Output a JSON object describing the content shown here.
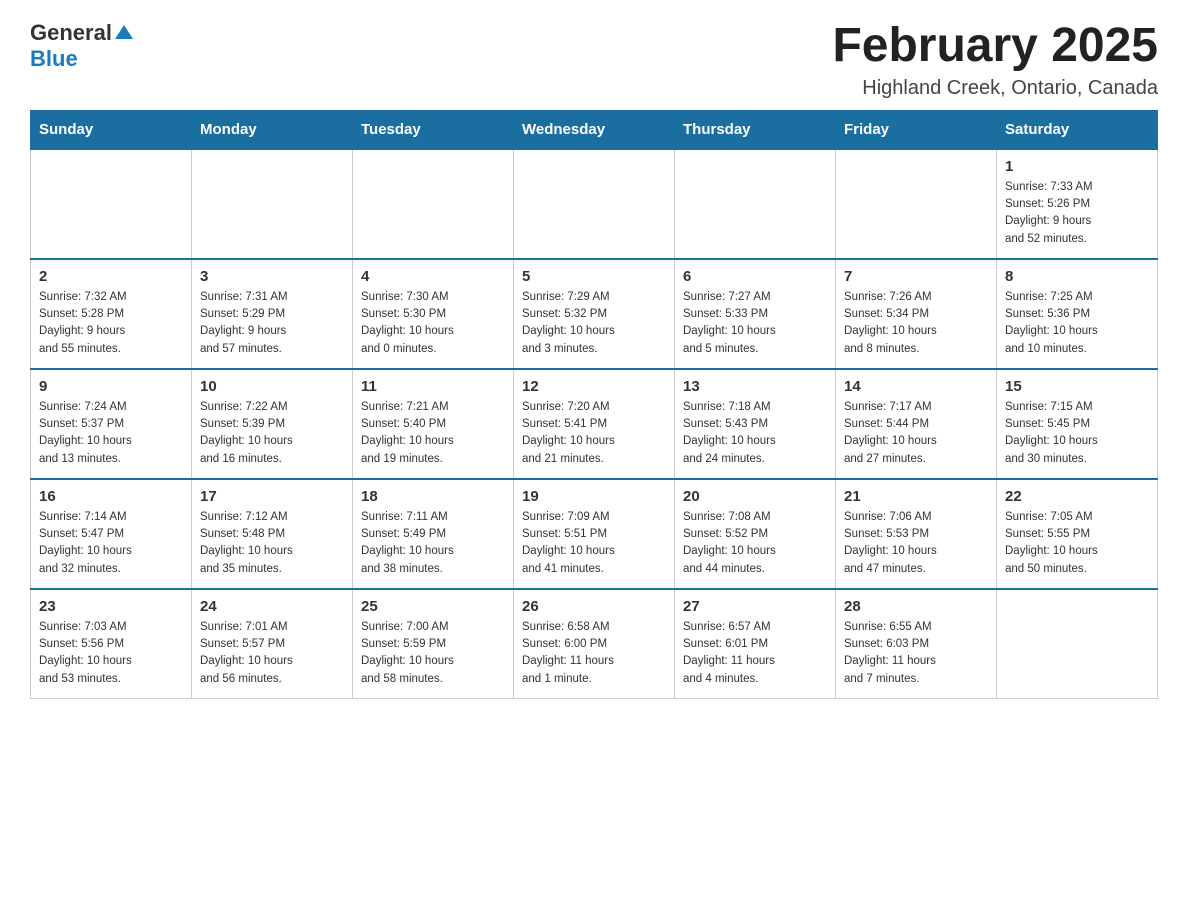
{
  "header": {
    "logo_general": "General",
    "logo_blue": "Blue",
    "month_title": "February 2025",
    "location": "Highland Creek, Ontario, Canada"
  },
  "weekdays": [
    "Sunday",
    "Monday",
    "Tuesday",
    "Wednesday",
    "Thursday",
    "Friday",
    "Saturday"
  ],
  "weeks": [
    [
      {
        "day": "",
        "info": ""
      },
      {
        "day": "",
        "info": ""
      },
      {
        "day": "",
        "info": ""
      },
      {
        "day": "",
        "info": ""
      },
      {
        "day": "",
        "info": ""
      },
      {
        "day": "",
        "info": ""
      },
      {
        "day": "1",
        "info": "Sunrise: 7:33 AM\nSunset: 5:26 PM\nDaylight: 9 hours\nand 52 minutes."
      }
    ],
    [
      {
        "day": "2",
        "info": "Sunrise: 7:32 AM\nSunset: 5:28 PM\nDaylight: 9 hours\nand 55 minutes."
      },
      {
        "day": "3",
        "info": "Sunrise: 7:31 AM\nSunset: 5:29 PM\nDaylight: 9 hours\nand 57 minutes."
      },
      {
        "day": "4",
        "info": "Sunrise: 7:30 AM\nSunset: 5:30 PM\nDaylight: 10 hours\nand 0 minutes."
      },
      {
        "day": "5",
        "info": "Sunrise: 7:29 AM\nSunset: 5:32 PM\nDaylight: 10 hours\nand 3 minutes."
      },
      {
        "day": "6",
        "info": "Sunrise: 7:27 AM\nSunset: 5:33 PM\nDaylight: 10 hours\nand 5 minutes."
      },
      {
        "day": "7",
        "info": "Sunrise: 7:26 AM\nSunset: 5:34 PM\nDaylight: 10 hours\nand 8 minutes."
      },
      {
        "day": "8",
        "info": "Sunrise: 7:25 AM\nSunset: 5:36 PM\nDaylight: 10 hours\nand 10 minutes."
      }
    ],
    [
      {
        "day": "9",
        "info": "Sunrise: 7:24 AM\nSunset: 5:37 PM\nDaylight: 10 hours\nand 13 minutes."
      },
      {
        "day": "10",
        "info": "Sunrise: 7:22 AM\nSunset: 5:39 PM\nDaylight: 10 hours\nand 16 minutes."
      },
      {
        "day": "11",
        "info": "Sunrise: 7:21 AM\nSunset: 5:40 PM\nDaylight: 10 hours\nand 19 minutes."
      },
      {
        "day": "12",
        "info": "Sunrise: 7:20 AM\nSunset: 5:41 PM\nDaylight: 10 hours\nand 21 minutes."
      },
      {
        "day": "13",
        "info": "Sunrise: 7:18 AM\nSunset: 5:43 PM\nDaylight: 10 hours\nand 24 minutes."
      },
      {
        "day": "14",
        "info": "Sunrise: 7:17 AM\nSunset: 5:44 PM\nDaylight: 10 hours\nand 27 minutes."
      },
      {
        "day": "15",
        "info": "Sunrise: 7:15 AM\nSunset: 5:45 PM\nDaylight: 10 hours\nand 30 minutes."
      }
    ],
    [
      {
        "day": "16",
        "info": "Sunrise: 7:14 AM\nSunset: 5:47 PM\nDaylight: 10 hours\nand 32 minutes."
      },
      {
        "day": "17",
        "info": "Sunrise: 7:12 AM\nSunset: 5:48 PM\nDaylight: 10 hours\nand 35 minutes."
      },
      {
        "day": "18",
        "info": "Sunrise: 7:11 AM\nSunset: 5:49 PM\nDaylight: 10 hours\nand 38 minutes."
      },
      {
        "day": "19",
        "info": "Sunrise: 7:09 AM\nSunset: 5:51 PM\nDaylight: 10 hours\nand 41 minutes."
      },
      {
        "day": "20",
        "info": "Sunrise: 7:08 AM\nSunset: 5:52 PM\nDaylight: 10 hours\nand 44 minutes."
      },
      {
        "day": "21",
        "info": "Sunrise: 7:06 AM\nSunset: 5:53 PM\nDaylight: 10 hours\nand 47 minutes."
      },
      {
        "day": "22",
        "info": "Sunrise: 7:05 AM\nSunset: 5:55 PM\nDaylight: 10 hours\nand 50 minutes."
      }
    ],
    [
      {
        "day": "23",
        "info": "Sunrise: 7:03 AM\nSunset: 5:56 PM\nDaylight: 10 hours\nand 53 minutes."
      },
      {
        "day": "24",
        "info": "Sunrise: 7:01 AM\nSunset: 5:57 PM\nDaylight: 10 hours\nand 56 minutes."
      },
      {
        "day": "25",
        "info": "Sunrise: 7:00 AM\nSunset: 5:59 PM\nDaylight: 10 hours\nand 58 minutes."
      },
      {
        "day": "26",
        "info": "Sunrise: 6:58 AM\nSunset: 6:00 PM\nDaylight: 11 hours\nand 1 minute."
      },
      {
        "day": "27",
        "info": "Sunrise: 6:57 AM\nSunset: 6:01 PM\nDaylight: 11 hours\nand 4 minutes."
      },
      {
        "day": "28",
        "info": "Sunrise: 6:55 AM\nSunset: 6:03 PM\nDaylight: 11 hours\nand 7 minutes."
      },
      {
        "day": "",
        "info": ""
      }
    ]
  ]
}
